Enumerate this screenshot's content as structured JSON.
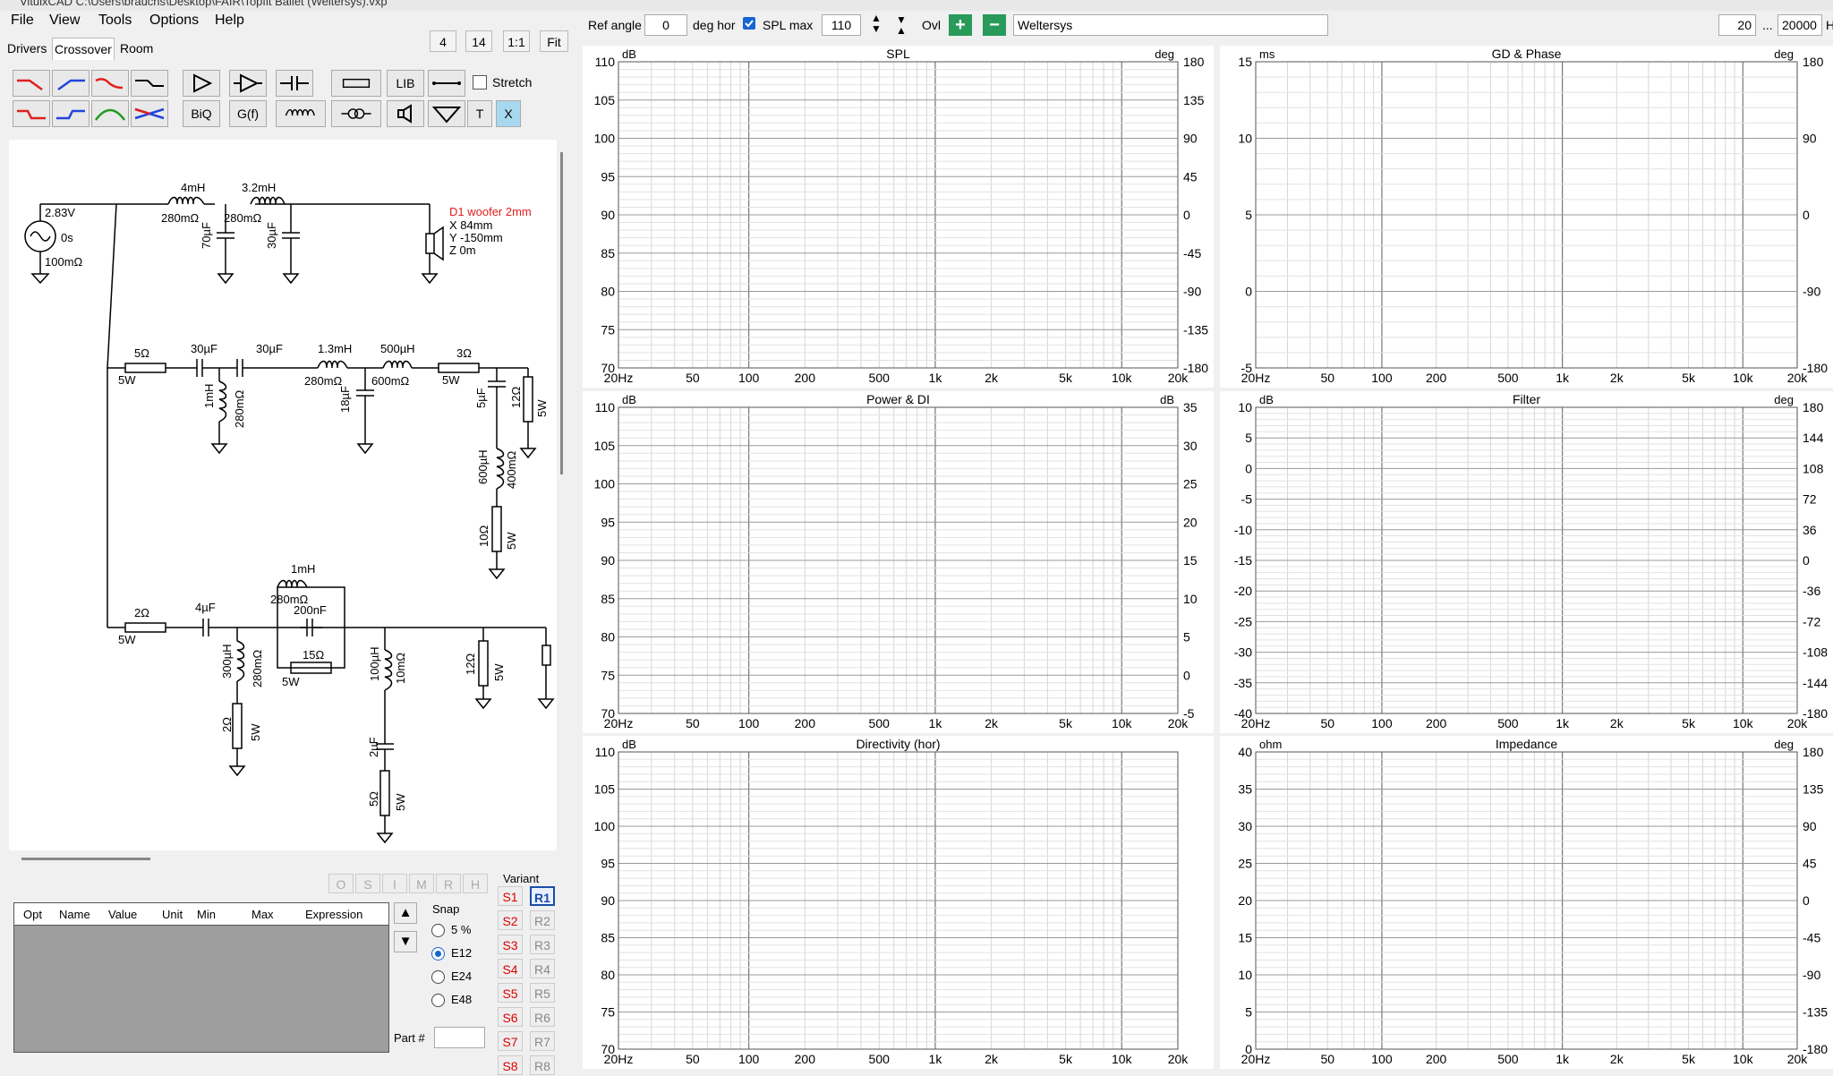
{
  "window": {
    "title": "VituixCAD C:\\Users\\brauchs\\Desktop\\FAIR\\Topfit Ballet (Weltersys).vxp"
  },
  "menu": [
    "File",
    "View",
    "Tools",
    "Options",
    "Help"
  ],
  "tabs": [
    "Drivers",
    "Crossover",
    "Room"
  ],
  "zoom_buttons": [
    "4",
    "14",
    "1:1",
    "Fit"
  ],
  "toolbar": {
    "ref_angle_label": "Ref angle",
    "ref_angle_value": "0",
    "deg_hor_label": "deg hor",
    "spl_max_label": "SPL max",
    "spl_max_value": "110",
    "ovl_label": "Ovl",
    "name_value": "Weltersys",
    "fmin_value": "20",
    "ellipsis": "...",
    "fmax_value": "20000",
    "h_label": "H"
  },
  "crossover_buttons": {
    "lib": "LIB",
    "biq": "BiQ",
    "gf": "G(f)",
    "t": "T",
    "x": "X",
    "stretch": "Stretch"
  },
  "schematic": {
    "source": [
      "2.83V",
      "0s",
      "100mΩ"
    ],
    "driver": [
      "D1 woofer 2mm",
      "X 84mm",
      "Y -150mm",
      "Z 0m"
    ],
    "labels": [
      "4mH",
      "280mΩ",
      "3.2mH",
      "280mΩ",
      "70µF",
      "30µF",
      "5Ω",
      "5W",
      "30µF",
      "30µF",
      "1mH",
      "280mΩ",
      "1.3mH",
      "280mΩ",
      "500µH",
      "600mΩ",
      "18µF",
      "3Ω",
      "5W",
      "5µF",
      "12Ω",
      "5W",
      "600µH",
      "400mΩ",
      "10Ω",
      "5W",
      "2Ω",
      "5W",
      "4µF",
      "1mH",
      "280mΩ",
      "200nF",
      "15Ω",
      "5W",
      "300µH",
      "280mΩ",
      "2Ω",
      "5W",
      "100µH",
      "10mΩ",
      "2µF",
      "5Ω",
      "5W",
      "12Ω",
      "5W"
    ]
  },
  "opt_buttons": [
    "O",
    "S",
    "I",
    "M",
    "R",
    "H"
  ],
  "param_table": {
    "columns": [
      "Opt",
      "Name",
      "Value",
      "Unit",
      "Min",
      "Max",
      "Expression"
    ]
  },
  "snap": {
    "label": "Snap",
    "options": [
      "5 %",
      "E12",
      "E24",
      "E48"
    ],
    "selected": "E12"
  },
  "variant": {
    "label": "Variant",
    "s": [
      "S1",
      "S2",
      "S3",
      "S4",
      "S5",
      "S6",
      "S7",
      "S8"
    ],
    "r": [
      "R1",
      "R2",
      "R3",
      "R4",
      "R5",
      "R6",
      "R7",
      "R8"
    ],
    "active_r": "R1"
  },
  "part_label": "Part #",
  "colors": {
    "magenta": "#cc22cc",
    "red": "#e02020",
    "blue": "#2233cc",
    "green": "#229922",
    "gray": "#777777"
  },
  "chart_data": [
    {
      "type": "line",
      "title": "SPL",
      "ylabel": "dB",
      "y2label": "deg",
      "yticks": [
        "110",
        "105",
        "100",
        "95",
        "90",
        "85",
        "80",
        "75",
        "70"
      ],
      "y2ticks": [
        "180",
        "135",
        "90",
        "45",
        "0",
        "-45",
        "-90",
        "-135",
        "-180"
      ],
      "xticks": [
        "20Hz",
        "50",
        "100",
        "200",
        "500",
        "1k",
        "2k",
        "5k",
        "10k",
        "20k"
      ],
      "xlim": [
        20,
        20000
      ],
      "ylim": [
        70,
        110
      ]
    },
    {
      "type": "line",
      "title": "GD & Phase",
      "ylabel": "ms",
      "y2label": "deg",
      "yticks": [
        "15",
        "10",
        "5",
        "0",
        "-5"
      ],
      "y2ticks": [
        "180",
        "90",
        "0",
        "-90",
        "-180"
      ],
      "xticks": [
        "20Hz",
        "50",
        "100",
        "200",
        "500",
        "1k",
        "2k",
        "5k",
        "10k",
        "20k"
      ],
      "xlim": [
        20,
        20000
      ],
      "ylim": [
        -5,
        15
      ]
    },
    {
      "type": "line",
      "title": "Power & DI",
      "ylabel": "dB",
      "y2label": "dB",
      "yticks": [
        "110",
        "105",
        "100",
        "95",
        "90",
        "85",
        "80",
        "75",
        "70"
      ],
      "y2ticks": [
        "35",
        "30",
        "25",
        "20",
        "15",
        "10",
        "5",
        "0",
        "-5"
      ],
      "xticks": [
        "20Hz",
        "50",
        "100",
        "200",
        "500",
        "1k",
        "2k",
        "5k",
        "10k",
        "20k"
      ],
      "xlim": [
        20,
        20000
      ],
      "ylim": [
        70,
        110
      ]
    },
    {
      "type": "line",
      "title": "Filter",
      "ylabel": "dB",
      "y2label": "deg",
      "yticks": [
        "10",
        "5",
        "0",
        "-5",
        "-10",
        "-15",
        "-20",
        "-25",
        "-30",
        "-35",
        "-40"
      ],
      "y2ticks": [
        "180",
        "144",
        "108",
        "72",
        "36",
        "0",
        "-36",
        "-72",
        "-108",
        "-144",
        "-180"
      ],
      "xticks": [
        "20Hz",
        "50",
        "100",
        "200",
        "500",
        "1k",
        "2k",
        "5k",
        "10k",
        "20k"
      ],
      "xlim": [
        20,
        20000
      ],
      "ylim": [
        -40,
        10
      ]
    },
    {
      "type": "line",
      "title": "Directivity (hor)",
      "ylabel": "dB",
      "yticks": [
        "110",
        "105",
        "100",
        "95",
        "90",
        "85",
        "80",
        "75",
        "70"
      ],
      "xticks": [
        "20Hz",
        "50",
        "100",
        "200",
        "500",
        "1k",
        "2k",
        "5k",
        "10k",
        "20k"
      ],
      "xlim": [
        20,
        20000
      ],
      "ylim": [
        70,
        110
      ]
    },
    {
      "type": "line",
      "title": "Impedance",
      "ylabel": "ohm",
      "y2label": "deg",
      "yticks": [
        "40",
        "35",
        "30",
        "25",
        "20",
        "15",
        "10",
        "5",
        "0"
      ],
      "y2ticks": [
        "180",
        "135",
        "90",
        "45",
        "0",
        "-45",
        "-90",
        "-135",
        "-180"
      ],
      "xticks": [
        "20Hz",
        "50",
        "100",
        "200",
        "500",
        "1k",
        "2k",
        "5k",
        "10k",
        "20k"
      ],
      "xlim": [
        20,
        20000
      ],
      "ylim": [
        0,
        40
      ]
    }
  ]
}
